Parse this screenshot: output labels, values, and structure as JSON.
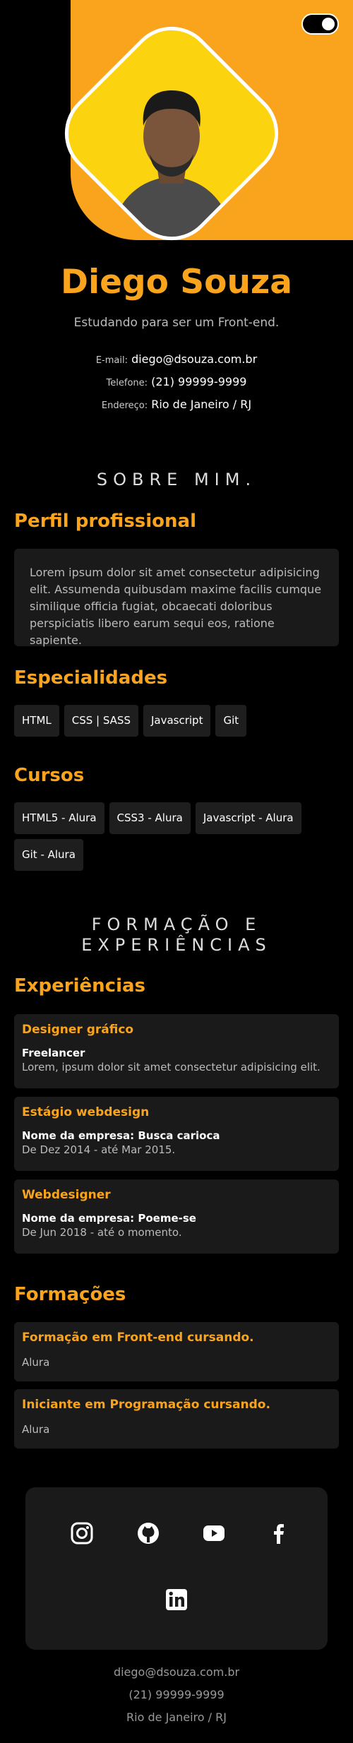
{
  "profile": {
    "name": "Diego Souza",
    "tagline": "Estudando para ser um Front-end."
  },
  "contact": {
    "email_label": "E-mail:",
    "email": "diego@dsouza.com.br",
    "phone_label": "Telefone:",
    "phone": "(21) 99999-9999",
    "address_label": "Endereço:",
    "address": "Rio de Janeiro / RJ"
  },
  "about": {
    "section_title": "SOBRE MIM.",
    "profile_heading": "Perfil profissional",
    "profile_text": "Lorem ipsum dolor sit amet consectetur adipisicing elit. Assumenda quibusdam maxime facilis cumque similique officia fugiat, obcaecati doloribus perspiciatis libero earum sequi eos, ratione sapiente.",
    "skills_heading": "Especialidades",
    "skills": [
      "HTML",
      "CSS | SASS",
      "Javascript",
      "Git"
    ],
    "courses_heading": "Cursos",
    "courses": [
      "HTML5 - Alura",
      "CSS3 - Alura",
      "Javascript - Alura",
      "Git - Alura"
    ]
  },
  "experience": {
    "section_title_1": "FORMAÇÃO E",
    "section_title_2": "EXPERIÊNCIAS",
    "heading": "Experiências",
    "items": [
      {
        "title": "Designer gráfico",
        "company": "Freelancer",
        "detail": "Lorem, ipsum dolor sit amet consectetur adipisicing elit."
      },
      {
        "title": "Estágio webdesign",
        "company": "Nome da empresa: Busca carioca",
        "detail": "De Dez 2014 - até Mar 2015."
      },
      {
        "title": "Webdesigner",
        "company": "Nome da empresa: Poeme-se",
        "detail": "De Jun 2018 - até o momento."
      }
    ]
  },
  "education": {
    "heading": "Formações",
    "items": [
      {
        "title": "Formação em Front-end cursando.",
        "school": "Alura"
      },
      {
        "title": "Iniciante em Programação cursando.",
        "school": "Alura"
      }
    ]
  },
  "social": {
    "icons": [
      "instagram-icon",
      "github-icon",
      "youtube-icon",
      "facebook-icon",
      "linkedin-icon"
    ]
  },
  "footer": {
    "email": "diego@dsouza.com.br",
    "phone": "(21) 99999-9999",
    "address": "Rio de Janeiro / RJ"
  },
  "colors": {
    "accent": "#f9a41c",
    "photo_bg": "#fcd30f",
    "card_bg": "#1a1a1a",
    "background": "#000000"
  }
}
